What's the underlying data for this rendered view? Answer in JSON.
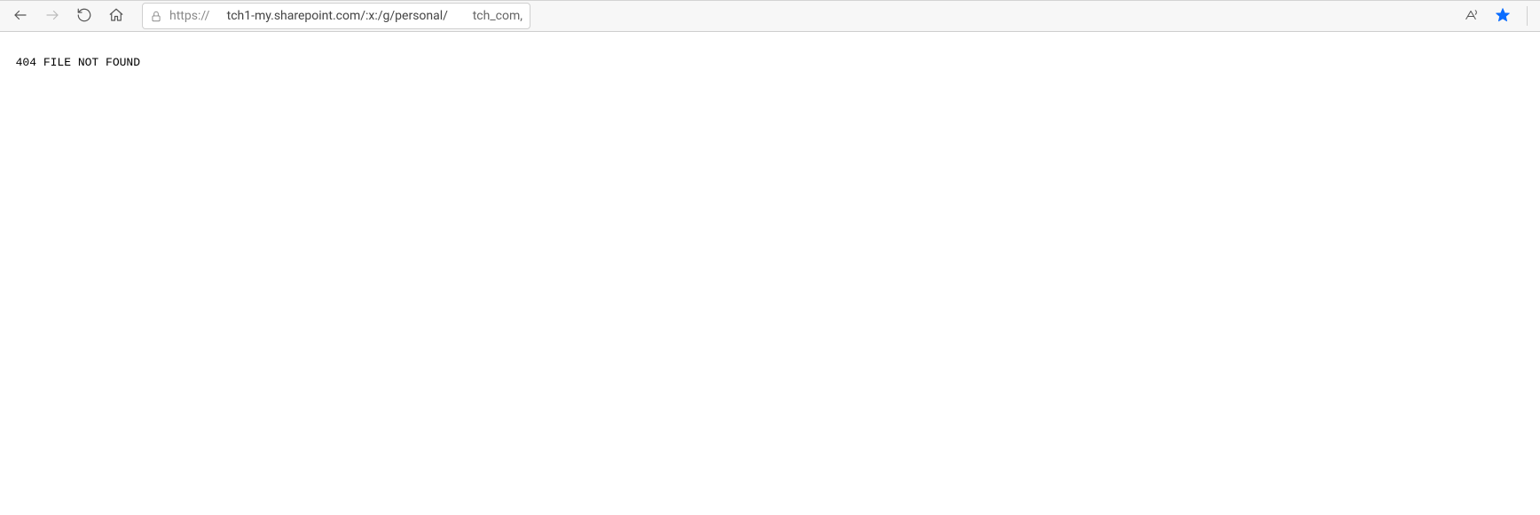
{
  "toolbar": {
    "url_parts": {
      "scheme": "https://",
      "host_path": "tch1-my.sharepoint.com/:x:/g/personal/",
      "tail": "tch_com,"
    }
  },
  "page": {
    "error_text": "404 FILE NOT FOUND"
  }
}
